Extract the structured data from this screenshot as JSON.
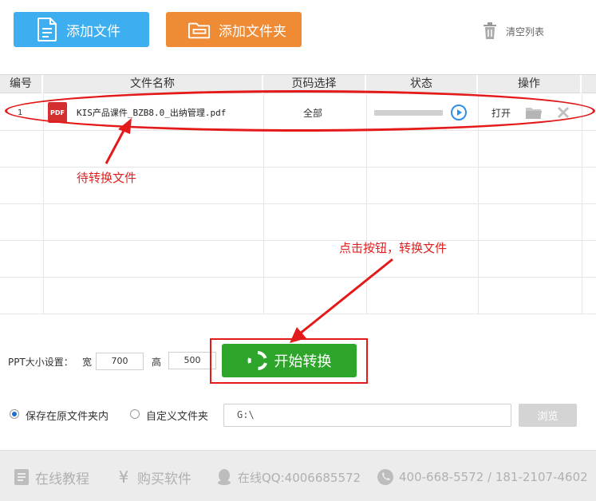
{
  "toolbar": {
    "add_file_label": "添加文件",
    "add_folder_label": "添加文件夹",
    "clear_list_label": "清空列表"
  },
  "table": {
    "headers": [
      "编号",
      "文件名称",
      "页码选择",
      "状态",
      "操作"
    ],
    "rows": [
      {
        "index": "1",
        "file_type_badge": "PDF",
        "file_name": "KIS产品课件_BZB8.0_出纳管理.pdf",
        "page_selection": "全部",
        "progress": 0,
        "open_label": "打开"
      }
    ]
  },
  "annotations": {
    "pending_file": "待转换文件",
    "click_hint": "点击按钮，转换文件"
  },
  "settings": {
    "ppt_size_label": "PPT大小设置：",
    "width_label": "宽",
    "width_value": "700",
    "height_label": "高",
    "height_value": "500"
  },
  "start_button_label": "开始转换",
  "save_options": {
    "original_folder_label": "保存在原文件夹内",
    "custom_folder_label": "自定义文件夹",
    "selected": "original",
    "path_value": "G:\\",
    "browse_label": "浏览"
  },
  "footer": {
    "tutorial_label": "在线教程",
    "buy_label": "购买软件",
    "qq_label": "在线QQ:4006685572",
    "phone_label": "400-668-5572 / 181-2107-4602"
  },
  "colors": {
    "blue_button": "#3daef0",
    "orange_button": "#ef8a35",
    "green_button": "#2da52b",
    "annotation_red": "#e41a1a"
  }
}
